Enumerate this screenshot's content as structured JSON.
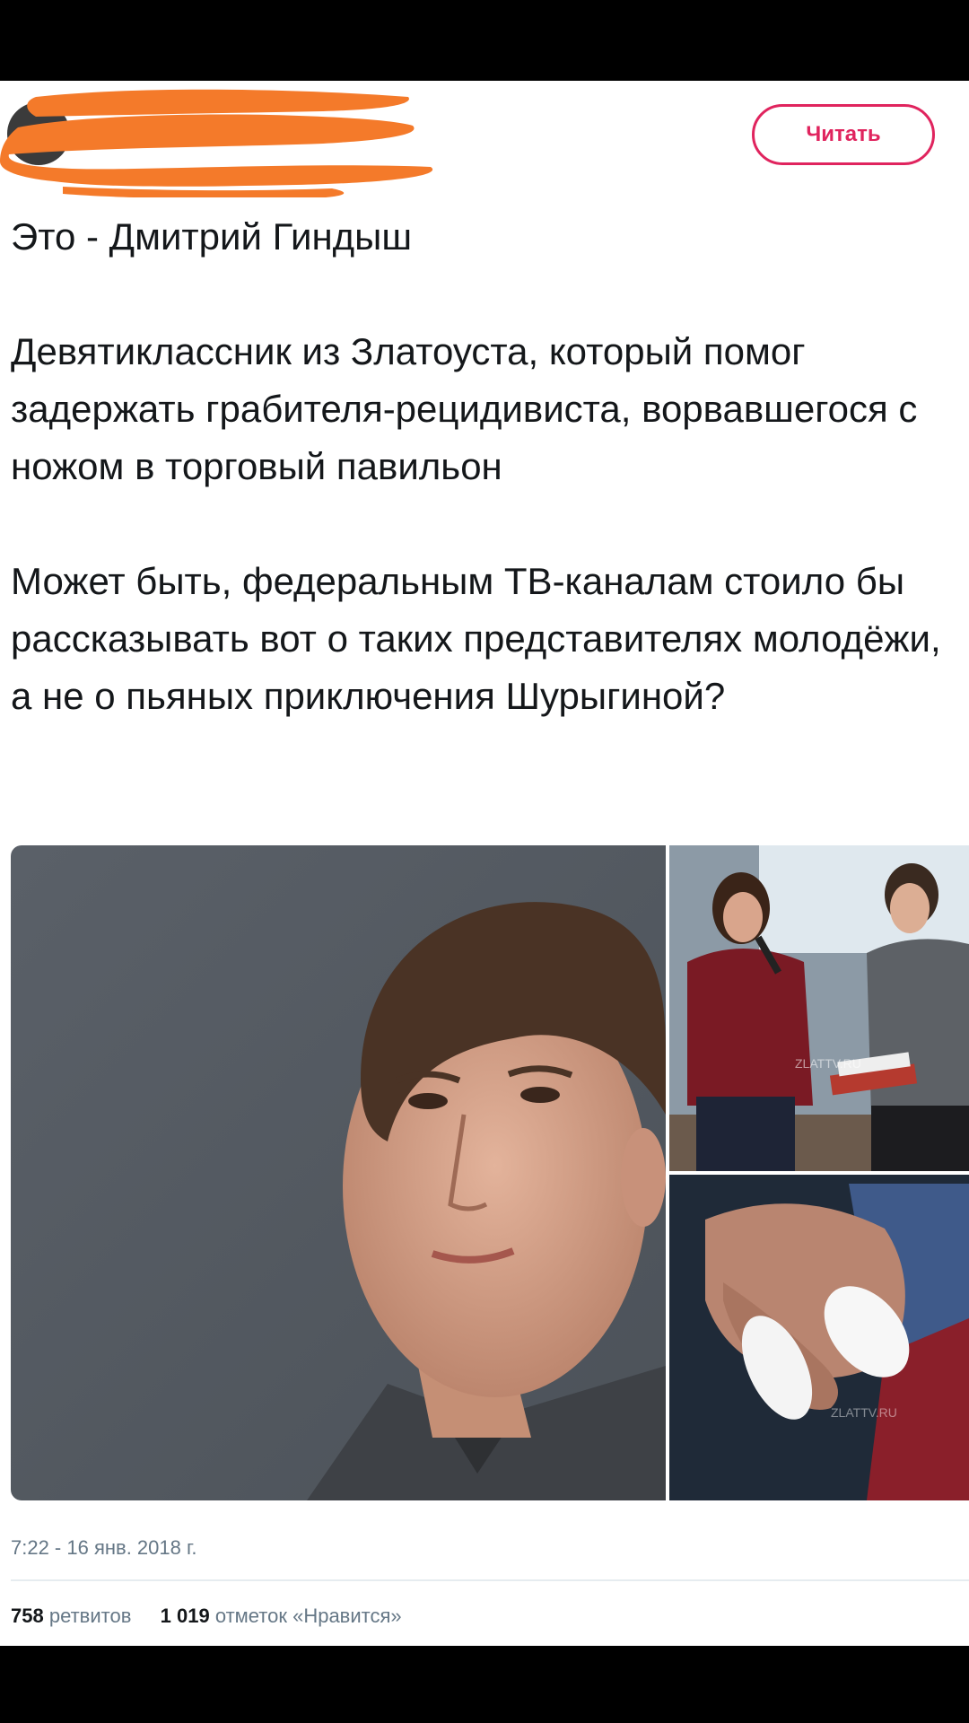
{
  "header": {
    "author_name": "",
    "author_handle": "",
    "follow_label": "Читать"
  },
  "tweet": {
    "paragraphs": [
      "Это - Дмитрий Гиндыш",
      "Девятиклассник из Златоуста, который помог задержать грабителя-рецидивиста, ворвавшегося с ножом в торговый павильон",
      "Может быть, федеральным ТВ-каналам стоило бы рассказывать вот о таких представителях молодёжи, а не о пьяных приключения Шурыгиной?"
    ]
  },
  "media": {
    "watermark_1": "ZLATTV.RU",
    "watermark_2": "ZLATTV.RU"
  },
  "meta": {
    "timestamp": "7:22 - 16 янв. 2018 г.",
    "retweets_count": "758",
    "retweets_label": "ретвитов",
    "likes_count": "1 019",
    "likes_label": "отметок «Нравится»"
  },
  "colors": {
    "accent": "#e0245e",
    "redaction": "#f47a2a",
    "text": "#14171a",
    "muted": "#657786"
  }
}
